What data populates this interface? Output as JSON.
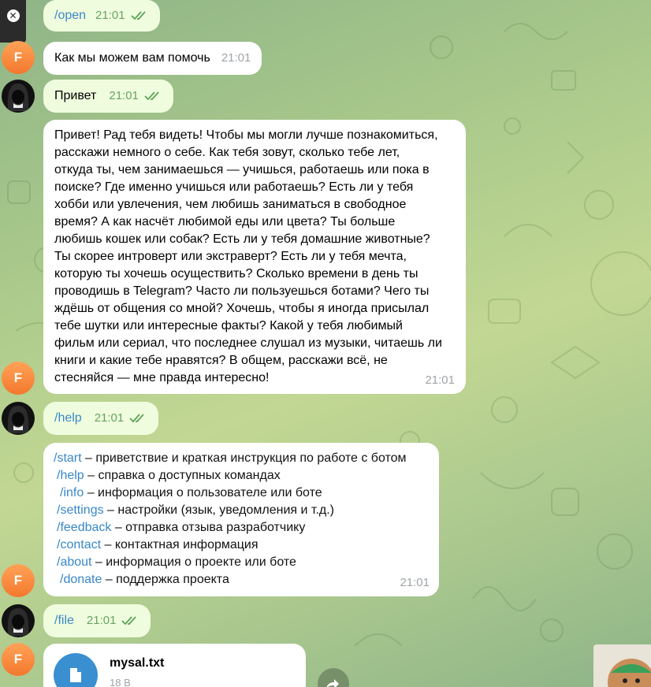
{
  "colors": {
    "outgoing_bubble": "#effdde",
    "incoming_bubble": "#ffffff",
    "link": "#3a87c8",
    "time_out": "#6aa163",
    "time_in": "#a0a4a8",
    "avatar_user": "#f3782e"
  },
  "top_close": {
    "icon": "close-icon"
  },
  "messages": {
    "m1": {
      "text": "/open",
      "time": "21:01"
    },
    "m2": {
      "text": "Как мы можем вам помочь",
      "time": "21:01",
      "avatar_letter": "F"
    },
    "m3": {
      "text": "Привет",
      "time": "21:01"
    },
    "m4": {
      "text": "Привет! Рад тебя видеть! Чтобы мы могли лучше познакомиться,\nрасскажи немного о себе. Как тебя зовут, сколько тебе лет,\nоткуда ты, чем занимаешься — учишься, работаешь или пока в\nпоиске? Где именно учишься или работаешь? Есть ли у тебя\nхобби или увлечения, чем любишь заниматься в свободное\nвремя? А как насчёт любимой еды или цвета? Ты больше\nлюбишь кошек или собак? Есть ли у тебя домашние животные?\nТы скорее интроверт или экстраверт? Есть ли у тебя мечта,\nкоторую ты хочешь осуществить? Сколько времени в день ты\nпроводишь в Telegram? Часто ли пользуешься ботами? Чего ты\nждёшь от общения со мной? Хочешь, чтобы я иногда присылал\nтебе шутки или интересные факты? Какой у тебя любимый\nфильм или сериал, что последнее слушал из музыки, читаешь ли\nкниги и какие тебе нравятся? В общем, расскажи всё, не\nстесняйся — мне правда интересно!",
      "time": "21:01",
      "avatar_letter": "F"
    },
    "m5": {
      "text": "/help",
      "time": "21:01"
    },
    "m6": {
      "time": "21:01",
      "avatar_letter": "F",
      "commands": [
        {
          "cmd": "/start",
          "desc": " – приветствие и краткая инструкция по работе с ботом"
        },
        {
          "cmd": " /help",
          "desc": " – справка о доступных командах"
        },
        {
          "cmd": "  /info",
          "desc": " – информация о пользователе или боте"
        },
        {
          "cmd": " /settings",
          "desc": " – настройки (язык, уведомления и т.д.)"
        },
        {
          "cmd": " /feedback",
          "desc": " – отправка отзыва разработчику"
        },
        {
          "cmd": " /contact",
          "desc": " – контактная информация"
        },
        {
          "cmd": " /about",
          "desc": " – информация о проекте или боте"
        },
        {
          "cmd": "  /donate",
          "desc": " – поддержка проекта"
        }
      ]
    },
    "m7": {
      "text": "/file",
      "time": "21:01"
    },
    "m8": {
      "file_name": "mysal.txt",
      "file_size": "18 B",
      "avatar_letter": "F"
    }
  }
}
